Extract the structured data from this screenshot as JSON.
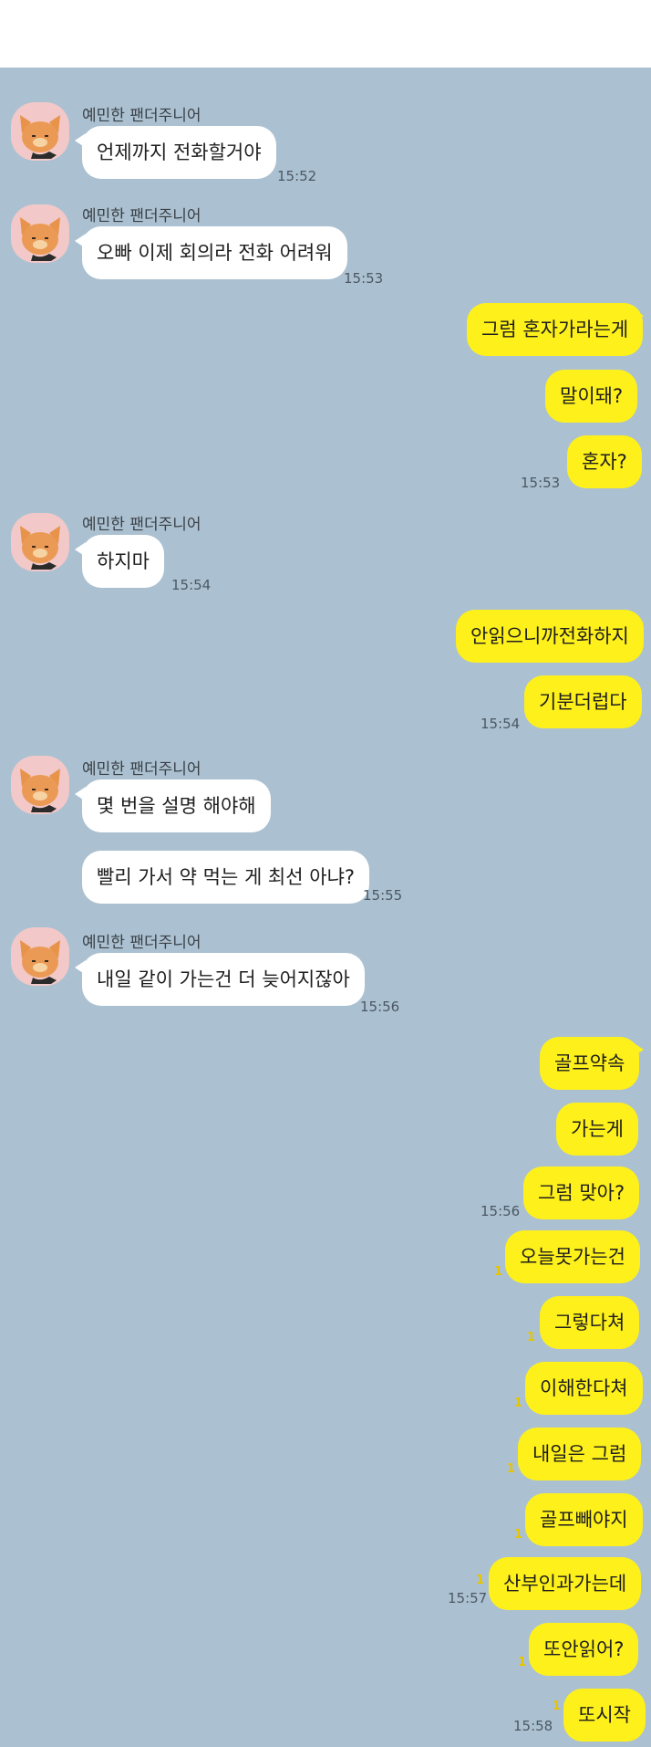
{
  "chat": {
    "contact_name": "예민한 팬더주니어",
    "background_color": "#abc1d1",
    "incoming_bubble_color": "#ffffff",
    "outgoing_bubble_color": "#fef01b",
    "unread_marker": "1",
    "avatar_icon": "fox-character-icon",
    "messages": [
      {
        "side": "in",
        "text": "언제까지 전화할거야",
        "time": "15:52"
      },
      {
        "side": "in",
        "text": "오빠 이제 회의라 전화 어려워",
        "time": "15:53"
      },
      {
        "side": "out",
        "text": "그럼 혼자가라는게",
        "time": ""
      },
      {
        "side": "out",
        "text": "말이돼?",
        "time": ""
      },
      {
        "side": "out",
        "text": "혼자?",
        "time": "15:53"
      },
      {
        "side": "in",
        "text": "하지마",
        "time": "15:54"
      },
      {
        "side": "out",
        "text": "안읽으니까전화하지",
        "time": ""
      },
      {
        "side": "out",
        "text": "기분더럽다",
        "time": "15:54"
      },
      {
        "side": "in",
        "text": "몇 번을 설명 해야해",
        "time": ""
      },
      {
        "side": "in",
        "text": "빨리 가서 약 먹는 게 최선 아냐?",
        "time": "15:55"
      },
      {
        "side": "in",
        "text": "내일 같이 가는건 더 늦어지잖아",
        "time": "15:56"
      },
      {
        "side": "out",
        "text": "골프약속",
        "time": ""
      },
      {
        "side": "out",
        "text": "가는게",
        "time": ""
      },
      {
        "side": "out",
        "text": "그럼 맞아?",
        "time": "15:56"
      },
      {
        "side": "out",
        "text": "오늘못가는건",
        "time": "",
        "unread": "1"
      },
      {
        "side": "out",
        "text": "그렇다쳐",
        "time": "",
        "unread": "1"
      },
      {
        "side": "out",
        "text": "이해한다쳐",
        "time": "",
        "unread": "1"
      },
      {
        "side": "out",
        "text": "내일은 그럼",
        "time": "",
        "unread": "1"
      },
      {
        "side": "out",
        "text": "골프빼야지",
        "time": "",
        "unread": "1"
      },
      {
        "side": "out",
        "text": "산부인과가는데",
        "time": "15:57",
        "unread": "1"
      },
      {
        "side": "out",
        "text": "또안읽어?",
        "time": "",
        "unread": "1"
      },
      {
        "side": "out",
        "text": "또시작",
        "time": "15:58",
        "unread": "1"
      }
    ]
  }
}
